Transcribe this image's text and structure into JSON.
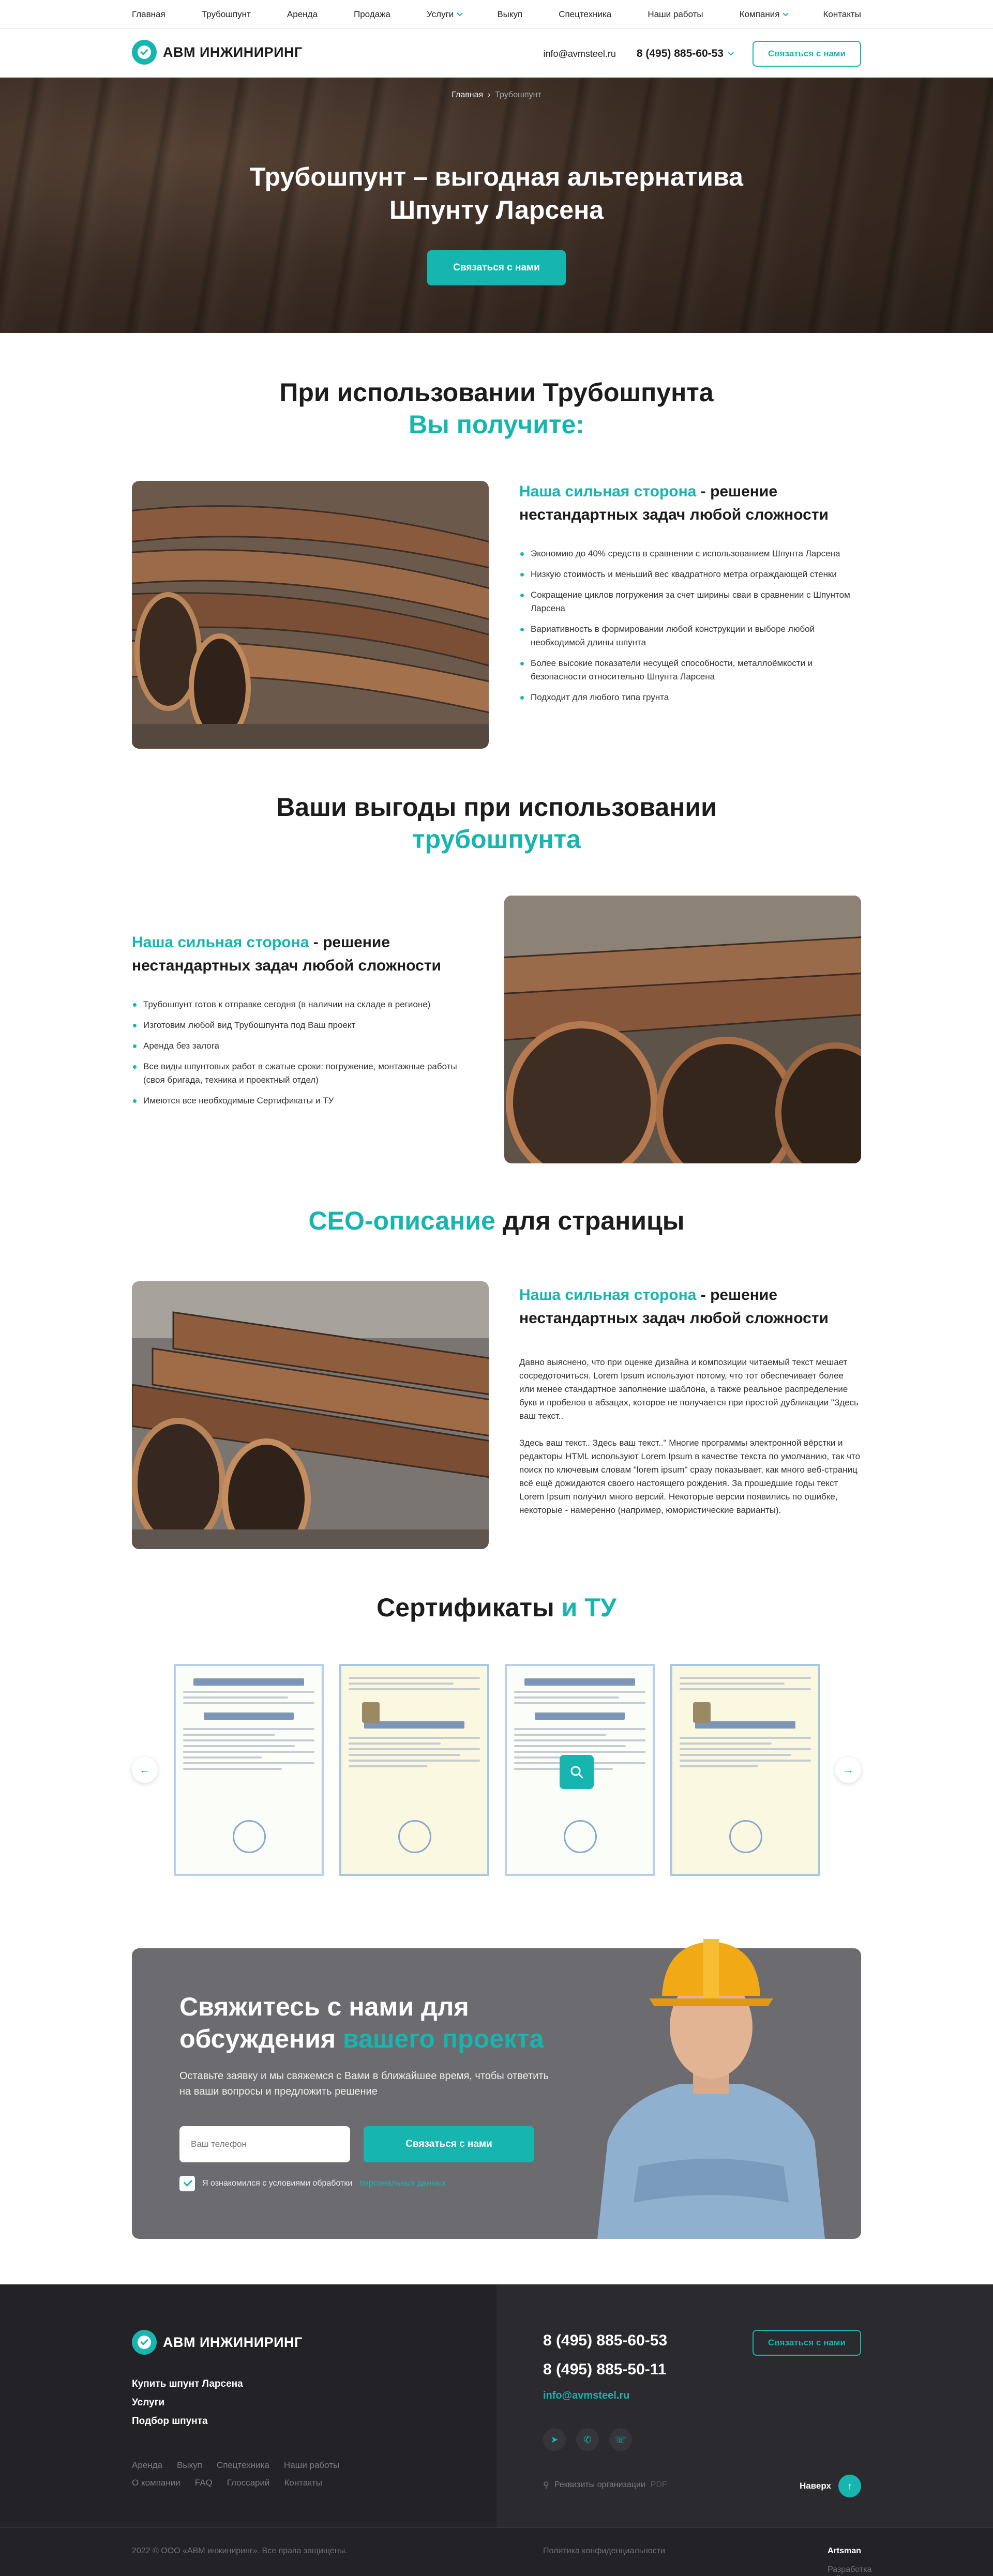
{
  "topnav": {
    "items": [
      "Главная",
      "Трубошпунт",
      "Аренда",
      "Продажа",
      "Услуги",
      "Выкуп",
      "Спецтехника",
      "Наши работы",
      "Компания",
      "Контакты"
    ]
  },
  "header": {
    "logo_text": "АВМ ИНЖИНИРИНГ",
    "email": "info@avmsteel.ru",
    "phone": "8 (495) 885-60-53",
    "cta": "Связаться с нами"
  },
  "hero": {
    "crumb_home": "Главная",
    "crumb_sep": "›",
    "crumb_current": "Трубошпунт",
    "title_line1": "Трубошпунт – выгодная альтернатива",
    "title_line2": "Шпунту Ларсена",
    "cta": "Связаться с нами"
  },
  "section1": {
    "title_line1": "При использовании Трубошпунта",
    "title_line2": "Вы получите:",
    "heading_accent": "Наша сильная сторона",
    "heading_rest": " - решение нестандартных задач любой сложности",
    "items": [
      "Экономию до 40% средств в сравнении с использованием Шпунта Ларсена",
      "Низкую стоимость и меньший вес квадратного метра ограждающей стенки",
      "Сокращение циклов погружения за счет ширины сваи в сравнении с Шпунтом Ларсена",
      "Вариативность в формировании любой конструкции и выборе любой необходимой длины шпунта",
      "Более высокие показатели несущей способности, металлоёмкости и безопасности относительно Шпунта Ларсена",
      "Подходит для любого типа грунта"
    ]
  },
  "section2": {
    "title_line1": "Ваши выгоды при использовании",
    "title_line2": "трубошпунта",
    "heading_accent": "Наша сильная сторона",
    "heading_rest": " - решение нестандартных задач любой сложности",
    "items": [
      "Трубошпунт готов к отправке сегодня (в наличии на складе в регионе)",
      "Изготовим любой вид Трубошпунта под Ваш проект",
      "Аренда без залога",
      "Все виды шпунтовых работ в сжатые сроки: погружение, монтажные работы (своя бригада, техника и проектный отдел)",
      "Имеются все необходимые Сертификаты и ТУ"
    ]
  },
  "section3": {
    "title_accent": "СЕО-описание",
    "title_rest": " для страницы",
    "heading_accent": "Наша сильная сторона",
    "heading_rest": " - решение нестандартных задач любой сложности",
    "para1": "Давно выяснено, что при оценке дизайна и композиции читаемый текст мешает сосредоточиться. Lorem Ipsum используют потому, что тот обеспечивает более или менее стандартное заполнение шаблона, а также реальное распределение букв и пробелов в абзацах, которое не получается при простой дубликации \"Здесь ваш текст..",
    "para2": "Здесь ваш текст.. Здесь ваш текст..\" Многие программы электронной вёрстки и редакторы HTML используют Lorem Ipsum в качестве текста по умолчанию, так что поиск по ключевым словам \"lorem ipsum\" сразу показывает, как много веб-страниц всё ещё дожидаются своего настоящего рождения. За прошедшие годы текст Lorem Ipsum получил много версий. Некоторые версии появились по ошибке, некоторые - намеренно (например, юмористические варианты)."
  },
  "certs": {
    "title_main": "Сертификаты",
    "title_accent": " и ТУ",
    "prev_icon": "arrow-left-icon",
    "next_icon": "arrow-right-icon",
    "zoom_icon": "search-icon"
  },
  "contact": {
    "title_line1": "Свяжитесь с нами для",
    "title_line2_plain": "обсуждения ",
    "title_line2_accent": "вашего проекта",
    "subtitle": "Оставьте заявку и мы свяжемся с Вами в ближайшее время, чтобы ответить на ваши вопросы и предложить решение",
    "phone_placeholder": "Ваш телефон",
    "submit": "Связаться с нами",
    "consent_text": "Я ознакомился с условиями обработки",
    "consent_link": "персональных данных"
  },
  "footer": {
    "logo_text": "АВМ ИНЖИНИРИНГ",
    "main_links": [
      "Купить шпунт Ларсена",
      "Услуги",
      "Подбор шпунта"
    ],
    "sub_links": [
      "Аренда",
      "Выкуп",
      "Спецтехника",
      "Наши работы",
      "О компании",
      "FAQ",
      "Глоссарий",
      "Контакты"
    ],
    "phone1": "8 (495) 885-60-53",
    "phone2": "8 (495) 885-50-11",
    "email": "info@avmsteel.ru",
    "requisites": "Реквизиты организации",
    "requisites_ext": "PDF",
    "cta": "Связаться с нами",
    "to_top": "Наверх",
    "copyright": "2022 © ООО «АВМ инжиниринг». Все права защищены.",
    "privacy": "Политика конфиденциальности",
    "dev_label": "Разработка сайта -",
    "dev_name": "Artsman"
  },
  "colors": {
    "accent": "#17b5b0",
    "contact_bg": "#6c6c70",
    "footer_bg": "#222227"
  }
}
